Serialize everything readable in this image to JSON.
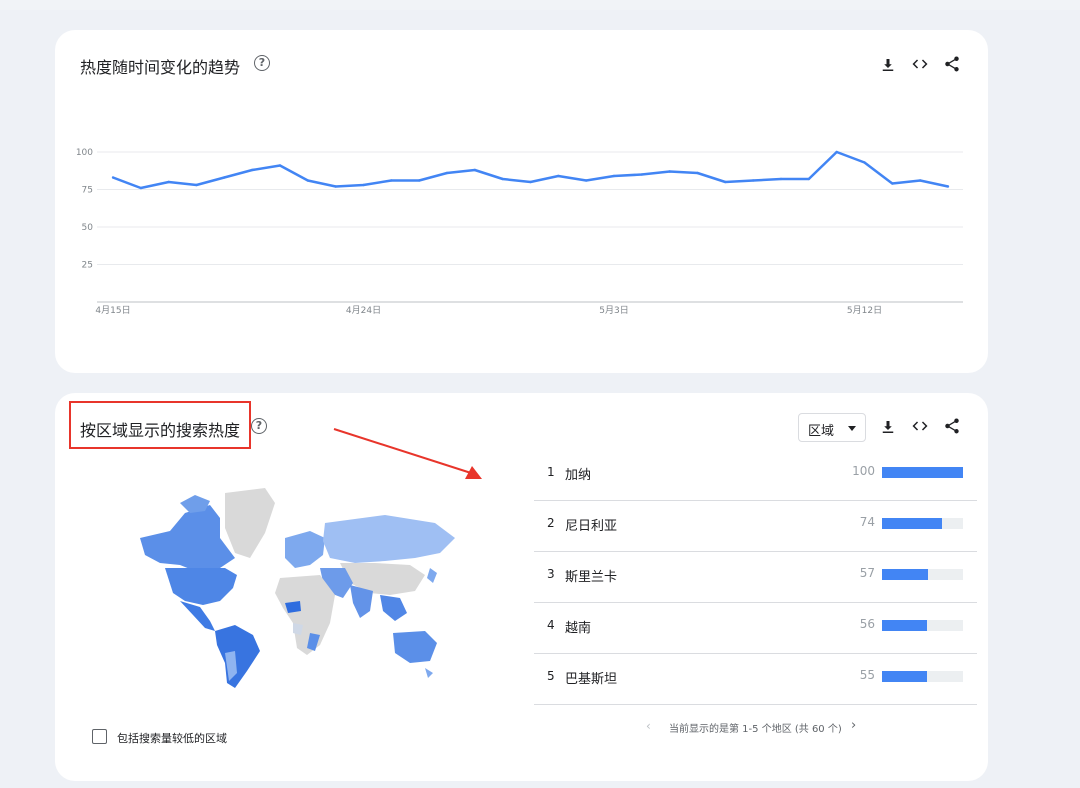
{
  "trend_card": {
    "title": "热度随时间变化的趋势",
    "help_glyph": "?"
  },
  "chart_data": {
    "type": "line",
    "title": "",
    "xlabel": "",
    "ylabel": "",
    "ylim": [
      0,
      100
    ],
    "yticks": [
      25,
      50,
      75,
      100
    ],
    "x_tick_labels": [
      "4月15日",
      "4月24日",
      "5月3日",
      "5月12日"
    ],
    "x_tick_indices": [
      0,
      9,
      18,
      27
    ],
    "grid": true,
    "color": "#4285f4",
    "series": [
      {
        "values": [
          83,
          76,
          80,
          78,
          83,
          88,
          91,
          81,
          77,
          78,
          81,
          81,
          86,
          88,
          82,
          80,
          84,
          81,
          84,
          85,
          87,
          86,
          80,
          81,
          82,
          82,
          100,
          93,
          79,
          81,
          77
        ]
      }
    ]
  },
  "region_card": {
    "title": "按区域显示的搜索热度",
    "help_glyph": "?",
    "region_select": "区域",
    "rows": [
      {
        "rank": "1",
        "name": "加纳",
        "value": "100",
        "score": 100
      },
      {
        "rank": "2",
        "name": "尼日利亚",
        "value": "74",
        "score": 74
      },
      {
        "rank": "3",
        "name": "斯里兰卡",
        "value": "57",
        "score": 57
      },
      {
        "rank": "4",
        "name": "越南",
        "value": "56",
        "score": 56
      },
      {
        "rank": "5",
        "name": "巴基斯坦",
        "value": "55",
        "score": 55
      }
    ],
    "pager_text": "当前显示的是第 1-5 个地区 (共 60 个)",
    "pager_prev": "‹",
    "pager_next": "›",
    "checkbox_label": "包括搜索量较低的区域"
  },
  "colors": {
    "accent": "#4285f4",
    "highlight": "#e8352b"
  }
}
